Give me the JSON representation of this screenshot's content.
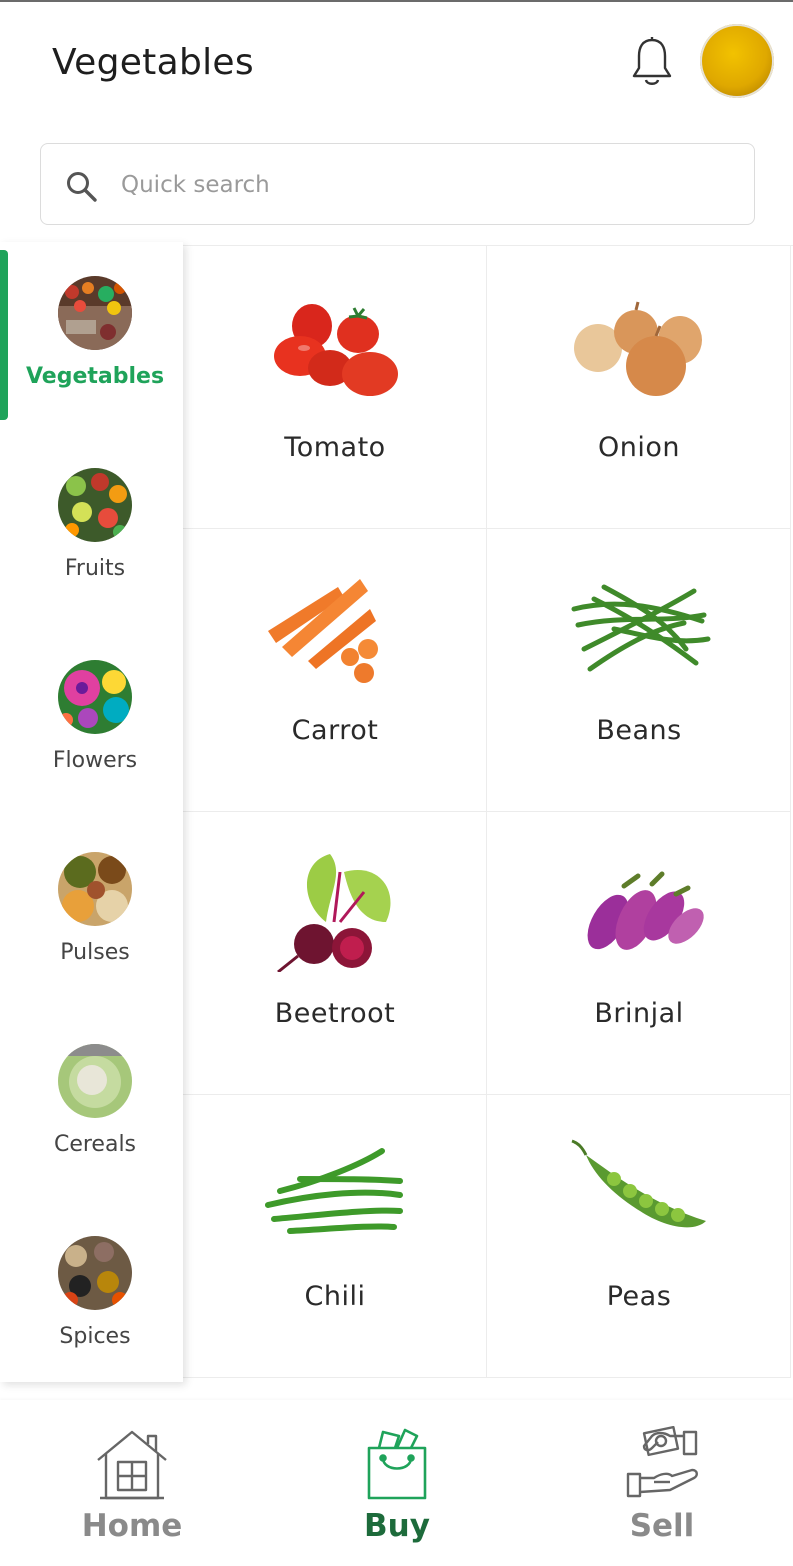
{
  "header": {
    "title": "Vegetables"
  },
  "search": {
    "placeholder": "Quick search",
    "value": ""
  },
  "categories": [
    {
      "label": "Vegetables",
      "active": true
    },
    {
      "label": "Fruits",
      "active": false
    },
    {
      "label": "Flowers",
      "active": false
    },
    {
      "label": "Pulses",
      "active": false
    },
    {
      "label": "Cereals",
      "active": false
    },
    {
      "label": "Spices",
      "active": false
    }
  ],
  "products": [
    {
      "name": "Tomato"
    },
    {
      "name": "Onion"
    },
    {
      "name": "Carrot"
    },
    {
      "name": "Beans"
    },
    {
      "name": "Beetroot"
    },
    {
      "name": "Brinjal"
    },
    {
      "name": "Chili"
    },
    {
      "name": "Peas"
    }
  ],
  "bottom_nav": {
    "home_label": "Home",
    "buy_label": "Buy",
    "sell_label": "Sell",
    "active": "Buy"
  },
  "colors": {
    "accent_green": "#1fa35a",
    "nav_active": "#1d6b3b",
    "nav_inactive": "#8a8a8a"
  },
  "icons": [
    "bell-icon",
    "avatar",
    "search-icon",
    "home-icon",
    "shopping-bag-icon",
    "sell-hand-icon"
  ]
}
